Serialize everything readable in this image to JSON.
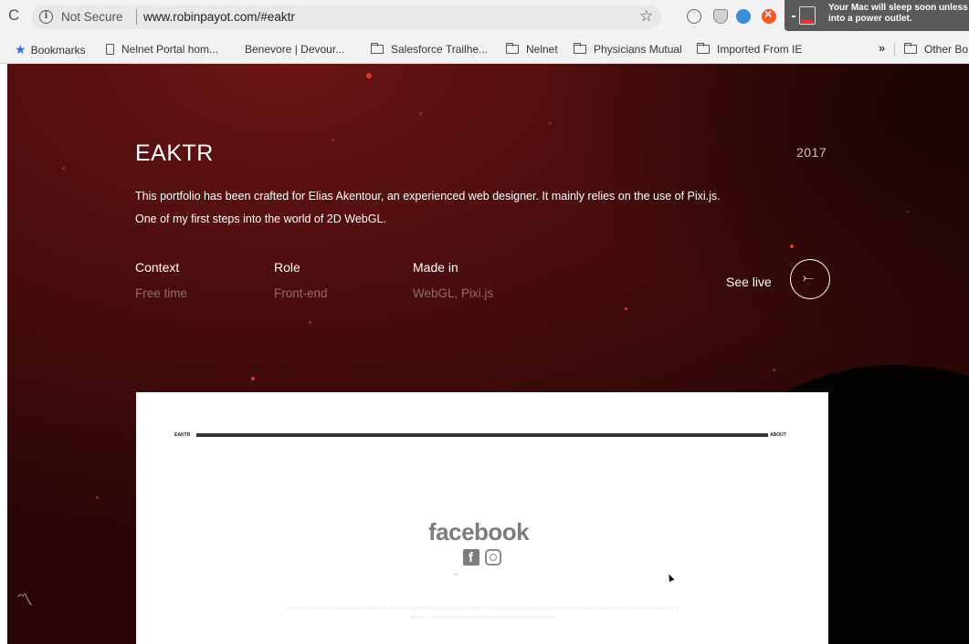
{
  "browser": {
    "reload_glyph": "C",
    "security_label": "Not Secure",
    "url": "www.robinpayot.com/#eaktr",
    "notification": "Your Mac will sleep soon unless plugged into a power outlet.",
    "extension_icons": [
      "tracker-icon",
      "shield-icon",
      "cloud-icon",
      "ublock-icon"
    ]
  },
  "bookmarks": {
    "items": [
      {
        "label": "Bookmarks",
        "icon": "star-icon"
      },
      {
        "label": "Nelnet Portal hom...",
        "icon": "page-icon"
      },
      {
        "label": "Benevore | Devour...",
        "icon": "none"
      },
      {
        "label": "Salesforce Trailhe...",
        "icon": "folder-icon"
      },
      {
        "label": "Nelnet",
        "icon": "folder-icon"
      },
      {
        "label": "Physicians Mutual",
        "icon": "folder-icon"
      },
      {
        "label": "Imported From IE",
        "icon": "folder-icon"
      },
      {
        "label": "Other Bo",
        "icon": "folder-icon"
      }
    ],
    "overflow": "»"
  },
  "project": {
    "title": "EAKTR",
    "year": "2017",
    "description_line1": "This portfolio has been crafted for Elias Akentour, an experienced web designer. It mainly relies on the use of Pixi.js.",
    "description_line2": "One of my first steps into the world of 2D WebGL.",
    "meta": [
      {
        "label": "Context",
        "value": "Free time"
      },
      {
        "label": "Role",
        "value": "Front-end"
      },
      {
        "label": "Made in",
        "value": "WebGL, Pixi.js"
      }
    ],
    "see_live": "See live",
    "arrow_glyph": "⤚"
  },
  "preview": {
    "brand": "EAKTR",
    "about": "ABOUT",
    "fb_word": "facebook",
    "small_caption": "Fb",
    "faint_text": "Lorem ipsum dolor sit amet consectetur adipiscing elit sed do eiusmod tempor incididunt ut labore et dolore magna aliqua ut enim ad minim veniam quis nostrud exercitation ullamco laboris nisi ut aliquip ex ea commodo consequat duis aute irure dolor in reprehenderit"
  },
  "colors": {
    "background": "#4a0d0d",
    "spark": "#e2342a",
    "meta_value": "#8f6e6e"
  }
}
